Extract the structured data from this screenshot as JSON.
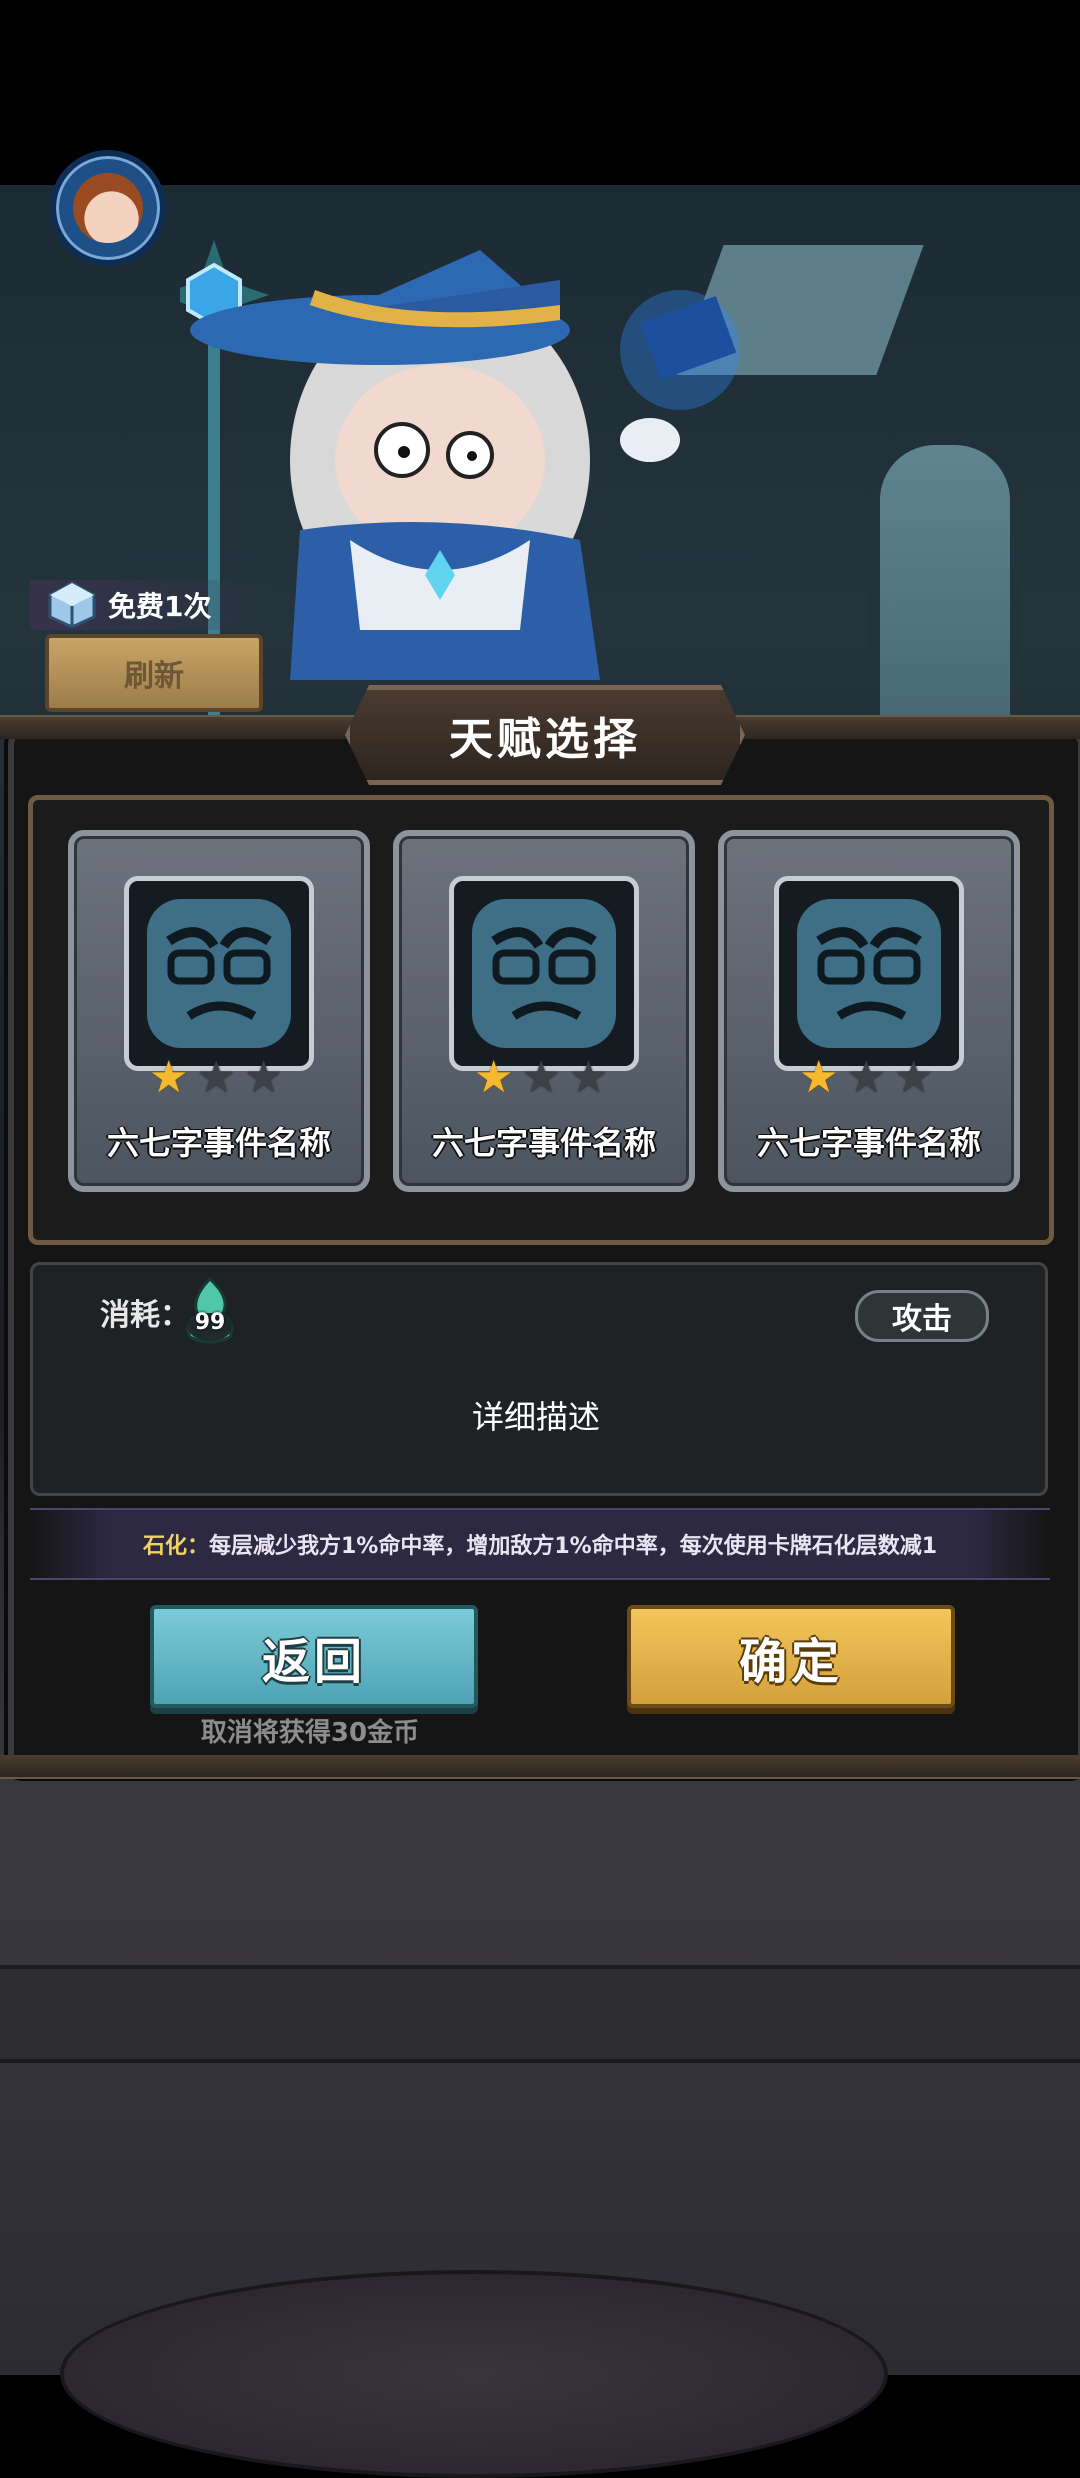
{
  "free_refresh": {
    "text": "免费1次",
    "button_label": "刷新"
  },
  "title": "天赋选择",
  "cards": [
    {
      "name": "六七字事件名称",
      "stars_on": 1,
      "stars_total": 3
    },
    {
      "name": "六七字事件名称",
      "stars_on": 1,
      "stars_total": 3
    },
    {
      "name": "六七字事件名称",
      "stars_on": 1,
      "stars_total": 3
    }
  ],
  "detail": {
    "cost_label": "消耗：",
    "cost_value": "99",
    "type_tag": "攻击",
    "description": "详细描述"
  },
  "petrify": {
    "key": "石化：",
    "text": "每层减少我方1%命中率，增加敌方1%命中率，每次使用卡牌石化层数减1"
  },
  "buttons": {
    "back": "返回",
    "confirm": "确定"
  },
  "cancel_note": "取消将获得30金币",
  "colors": {
    "confirm": "#e0ad45",
    "back": "#63b6c6",
    "star_on": "#f5b82e",
    "petrify_key": "#f2d261"
  }
}
